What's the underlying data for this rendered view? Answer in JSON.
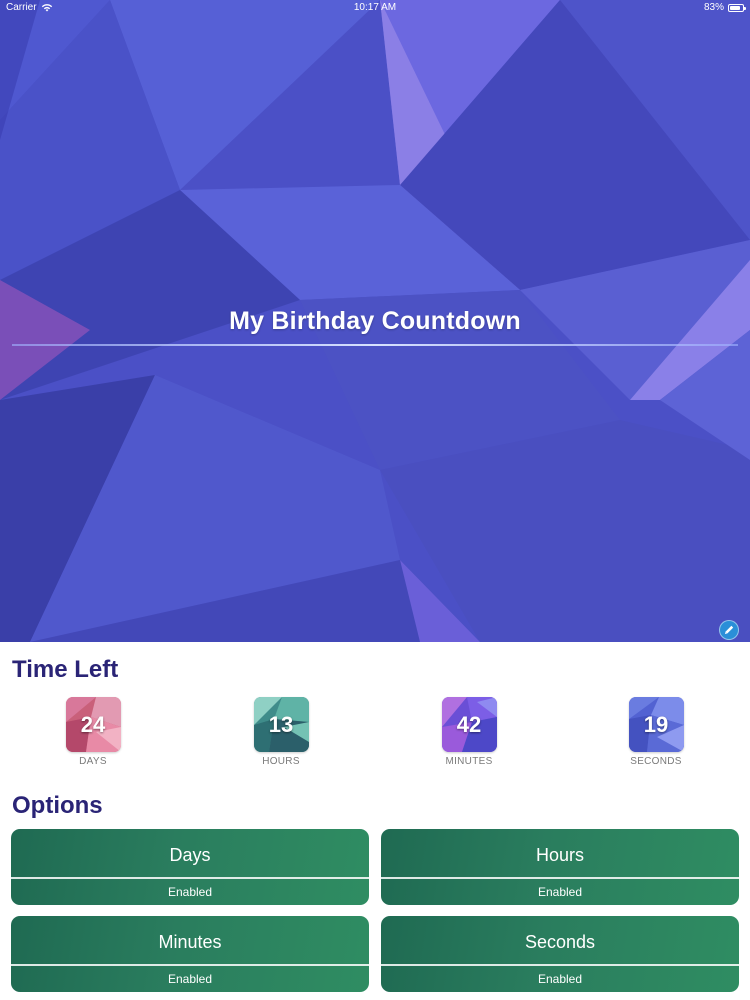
{
  "status_bar": {
    "carrier": "Carrier",
    "time": "10:17 AM",
    "battery_percent": "83%",
    "battery_level": 0.83
  },
  "hero": {
    "title": "My Birthday Countdown",
    "edit_icon": "pencil-icon"
  },
  "time_left": {
    "title": "Time Left",
    "counters": [
      {
        "value": "24",
        "label": "DAYS"
      },
      {
        "value": "13",
        "label": "HOURS"
      },
      {
        "value": "42",
        "label": "MINUTES"
      },
      {
        "value": "19",
        "label": "SECONDS"
      }
    ]
  },
  "options": {
    "title": "Options",
    "items": [
      {
        "name": "Days",
        "status": "Enabled"
      },
      {
        "name": "Hours",
        "status": "Enabled"
      },
      {
        "name": "Minutes",
        "status": "Enabled"
      },
      {
        "name": "Seconds",
        "status": "Enabled"
      }
    ]
  },
  "colors": {
    "section_title": "#2a2476",
    "option_green": "#2a7d5e",
    "hero_blue": "#4a4fc4",
    "edit_button": "#2a8fd8"
  }
}
